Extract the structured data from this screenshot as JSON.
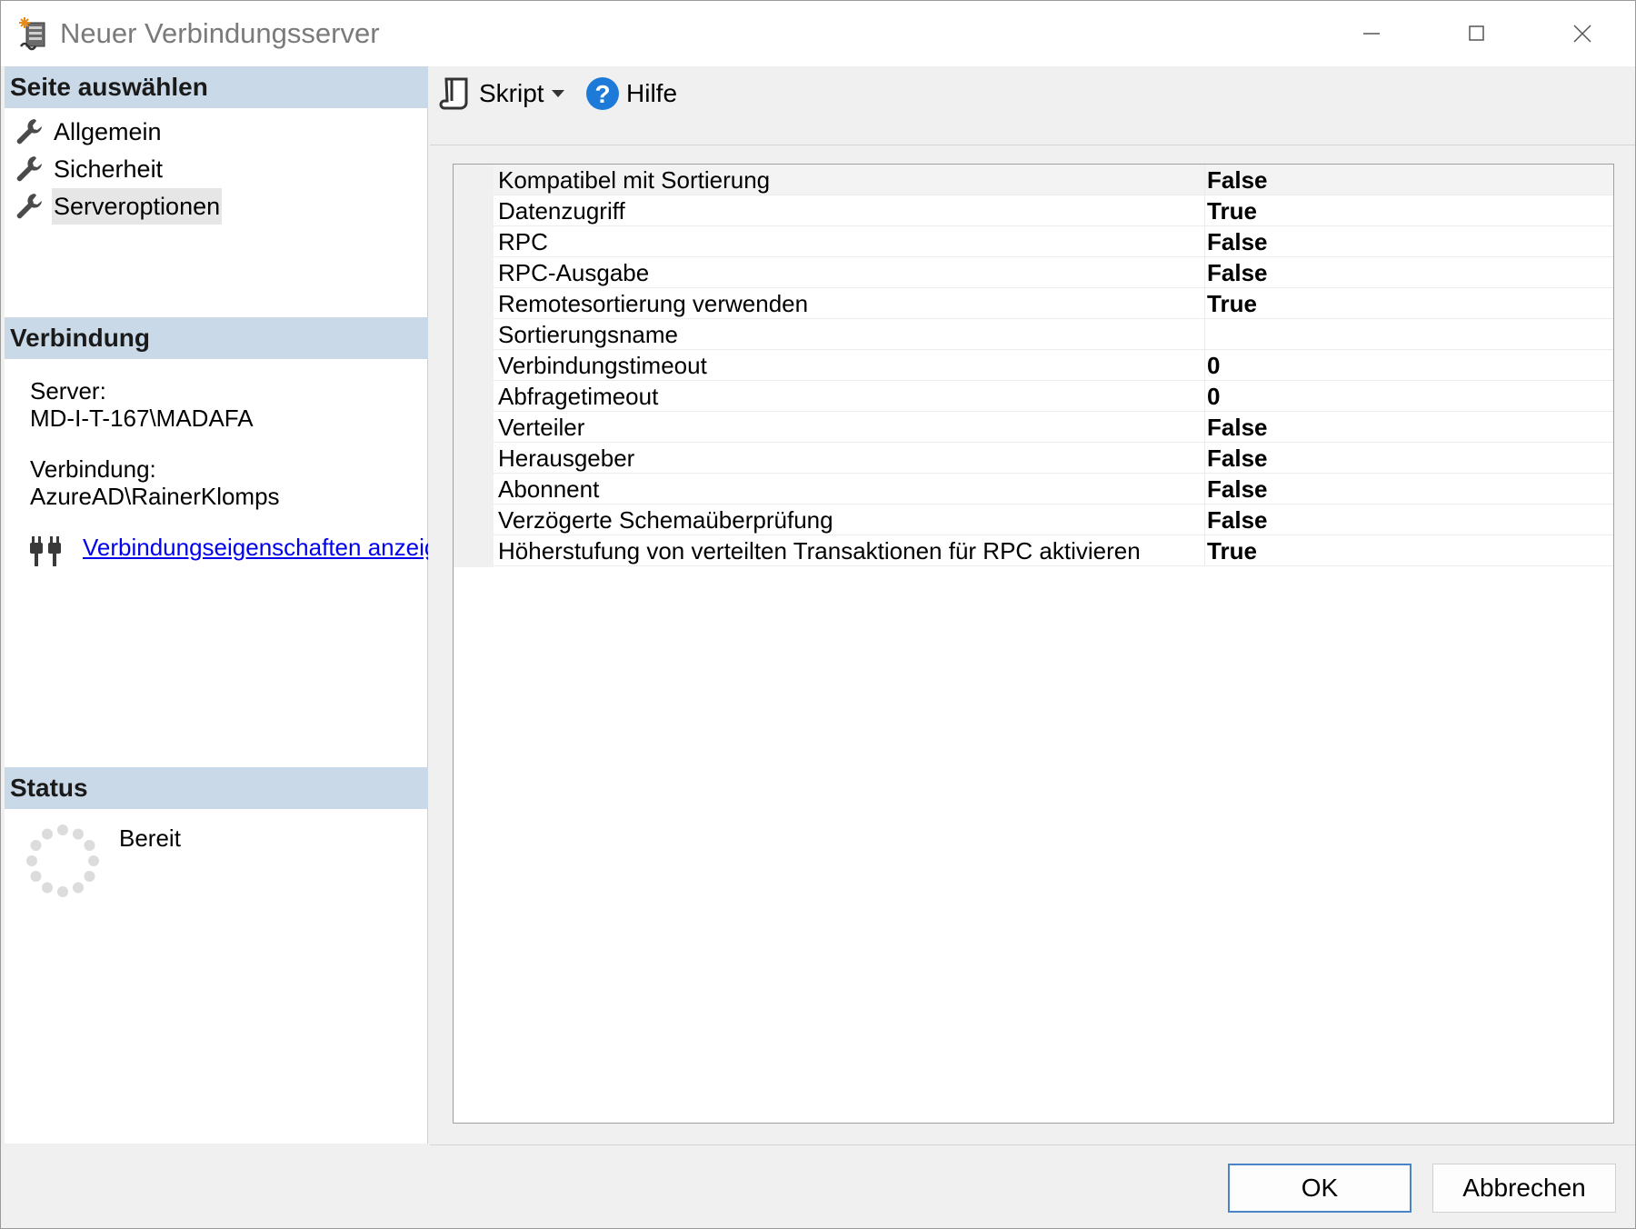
{
  "window": {
    "title": "Neuer Verbindungsserver"
  },
  "sidebar": {
    "select_page_header": "Seite auswählen",
    "items": [
      {
        "label": "Allgemein",
        "selected": false
      },
      {
        "label": "Sicherheit",
        "selected": false
      },
      {
        "label": "Serveroptionen",
        "selected": true
      }
    ],
    "connection": {
      "header": "Verbindung",
      "server_label": "Server:",
      "server_value": "MD-I-T-167\\MADAFA",
      "connection_label": "Verbindung:",
      "connection_value": "AzureAD\\RainerKlomps",
      "properties_link": "Verbindungseigenschaften anzeigen"
    },
    "status": {
      "header": "Status",
      "value": "Bereit"
    }
  },
  "toolbar": {
    "script_label": "Skript",
    "help_label": "Hilfe"
  },
  "properties": [
    {
      "name": "Kompatibel mit Sortierung",
      "value": "False"
    },
    {
      "name": "Datenzugriff",
      "value": "True"
    },
    {
      "name": "RPC",
      "value": "False"
    },
    {
      "name": "RPC-Ausgabe",
      "value": "False"
    },
    {
      "name": "Remotesortierung verwenden",
      "value": "True"
    },
    {
      "name": "Sortierungsname",
      "value": ""
    },
    {
      "name": "Verbindungstimeout",
      "value": "0"
    },
    {
      "name": "Abfragetimeout",
      "value": "0"
    },
    {
      "name": "Verteiler",
      "value": "False"
    },
    {
      "name": "Herausgeber",
      "value": "False"
    },
    {
      "name": "Abonnent",
      "value": "False"
    },
    {
      "name": "Verzögerte Schemaüberprüfung",
      "value": "False"
    },
    {
      "name": "Höherstufung von verteilten Transaktionen für RPC aktivieren",
      "value": "True"
    }
  ],
  "footer": {
    "ok_label": "OK",
    "cancel_label": "Abbrechen"
  },
  "colors": {
    "section_header_bg": "#c9d9e8",
    "link": "#0000ee",
    "help_icon": "#1e7ad8",
    "default_button_border": "#4a86c7"
  },
  "icons": {
    "app": "linked-server-icon",
    "nav": "wrench-icon",
    "script": "script-icon",
    "help": "help-icon",
    "connection": "plug-icon",
    "status": "progress-spinner-icon"
  }
}
